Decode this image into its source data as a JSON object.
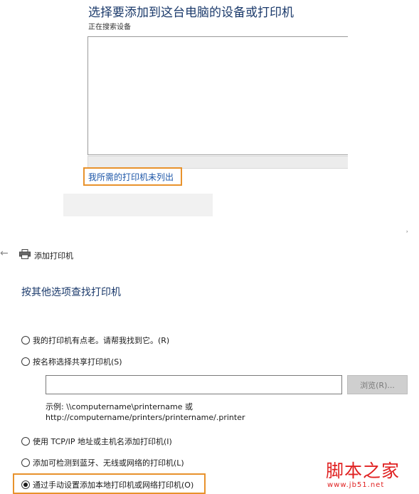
{
  "top_panel": {
    "title": "选择要添加到这台电脑的设备或打印机",
    "status": "正在搜索设备",
    "not_listed_link": "我所需的打印机未列出"
  },
  "wizard": {
    "title": "添加打印机",
    "heading": "按其他选项查找打印机",
    "options": {
      "old": "我的打印机有点老。请帮我找到它。(R)",
      "share": "按名称选择共享打印机(S)",
      "tcp": "使用 TCP/IP 地址或主机名添加打印机(I)",
      "bt": "添加可检测到蓝牙、无线或网络的打印机(L)",
      "manual": "通过手动设置添加本地打印机或网络打印机(O)"
    },
    "selected_option": "manual",
    "share_input": {
      "value": ""
    },
    "browse_label": "浏览(R)...",
    "example_line1": "示例: \\\\computername\\printername 或",
    "example_line2": "http://computername/printers/printername/.printer"
  },
  "watermark": {
    "main": "脚本之家",
    "url": "www.jb51.net"
  },
  "colors": {
    "heading_blue": "#1b3a6b",
    "link_blue": "#1e57a8",
    "highlight_orange": "#e8922c",
    "watermark_red": "#e02020"
  },
  "icons": {
    "back": "back-arrow-icon",
    "printer": "printer-icon"
  }
}
